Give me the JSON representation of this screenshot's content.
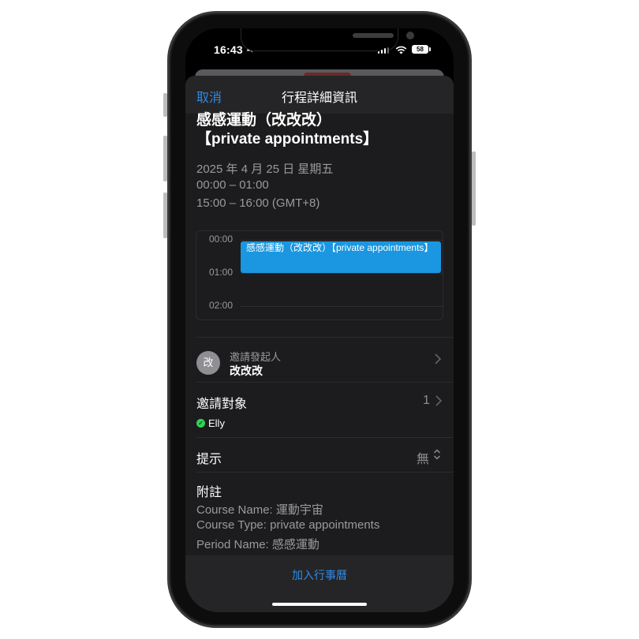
{
  "status_bar": {
    "time": "16:43",
    "battery": "58",
    "icons": [
      "bell-slash-icon",
      "signal-icon",
      "wifi-icon",
      "battery-icon"
    ]
  },
  "nav": {
    "cancel_label": "取消",
    "title": "行程詳細資訊"
  },
  "event": {
    "title_line1": "感感運動（改改改）",
    "title_line2": "【private appointments】",
    "date": "2025 年 4 月 25 日 星期五",
    "time_local": "00:00 – 01:00",
    "time_other_tz": "15:00 – 16:00 (GMT+8)"
  },
  "mini_calendar": {
    "hours": [
      "00:00",
      "01:00",
      "02:00"
    ],
    "event_label": "感感運動（改改改）【private appointments】",
    "event_color": "#1a97e0"
  },
  "inviter": {
    "avatar_text": "改",
    "label": "邀請發起人",
    "name": "改改改"
  },
  "invitees": {
    "label": "邀請對象",
    "count": "1",
    "attendees": [
      {
        "name": "Elly",
        "status_color": "#30d158"
      }
    ]
  },
  "alert": {
    "label": "提示",
    "value": "無"
  },
  "notes": {
    "label": "附註",
    "lines": [
      "Course Name: 運動宇宙",
      "Course Type: private appointments",
      "Period Name: 感感運動"
    ]
  },
  "footer": {
    "add_label": "加入行事曆"
  },
  "colors": {
    "accent": "#2f8ae4",
    "sheet_bg": "#1c1c1e",
    "nav_bg": "#252527"
  }
}
